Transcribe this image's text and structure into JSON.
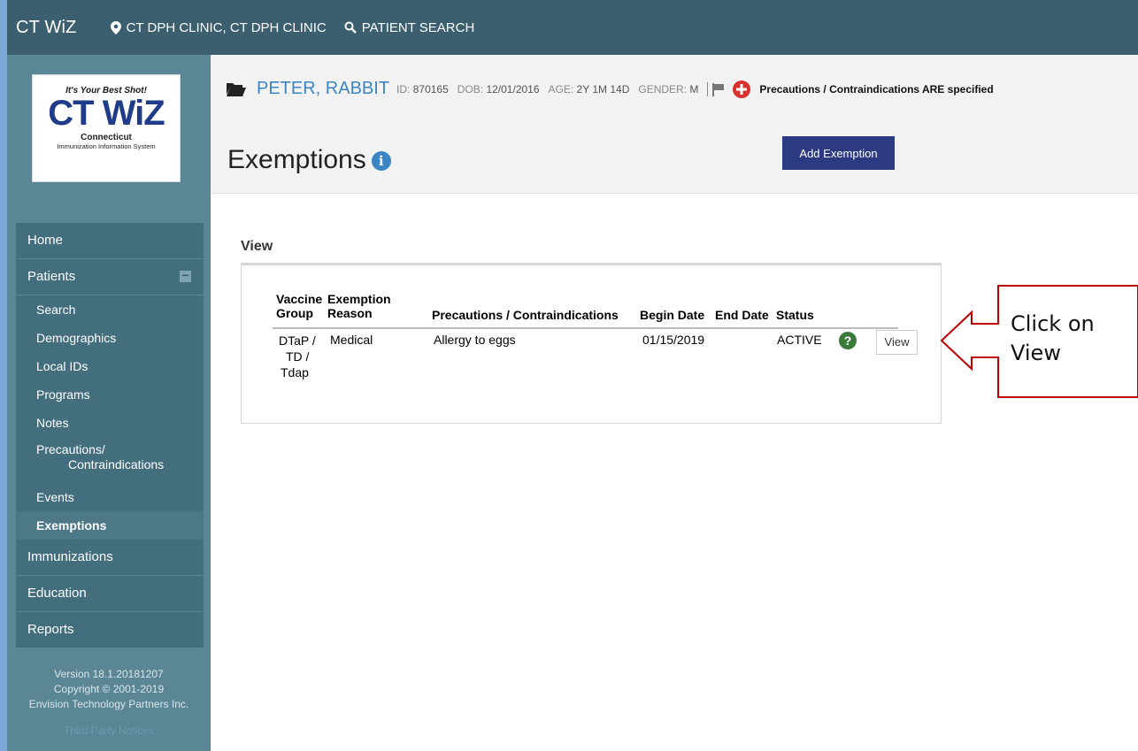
{
  "topbar": {
    "brand": "CT WiZ",
    "clinic": "CT DPH CLINIC, CT DPH CLINIC",
    "patient_search": "PATIENT SEARCH"
  },
  "logo": {
    "tagline": "It's Your Best Shot!",
    "name": "CT WiZ",
    "state": "Connecticut",
    "system": "Immunization Information System"
  },
  "sidebar": {
    "home": "Home",
    "patients": "Patients",
    "sub_items": [
      "Search",
      "Demographics",
      "Local IDs",
      "Programs",
      "Notes"
    ],
    "precautions_line1": "Precautions/",
    "precautions_line2": "Contraindications",
    "events": "Events",
    "exemptions": "Exemptions",
    "immunizations": "Immunizations",
    "education": "Education",
    "reports": "Reports",
    "version": "Version 18.1.20181207",
    "copyright": "Copyright © 2001-2019",
    "company": "Envision Technology Partners Inc.",
    "third_party": "Third Party Notices"
  },
  "patient": {
    "name": "PETER, RABBIT",
    "id_label": "ID:",
    "id": "870165",
    "dob_label": "DOB:",
    "dob": "12/01/2016",
    "age_label": "AGE:",
    "age": "2Y 1M 14D",
    "gender_label": "GENDER:",
    "gender": "M",
    "precautions_text": "Precautions / Contraindications ARE specified"
  },
  "page": {
    "title": "Exemptions",
    "add_button": "Add Exemption",
    "view_heading": "View"
  },
  "table": {
    "headers": {
      "vaccine_line1": "Vaccine",
      "vaccine_line2": "Group",
      "exemption_line1": "Exemption",
      "exemption_line2": "Reason",
      "precautions": "Precautions / Contraindications",
      "begin": "Begin Date",
      "end": "End Date",
      "status": "Status"
    },
    "row": {
      "vaccine_line1": "DTaP /",
      "vaccine_line2": "TD /",
      "vaccine_line3": "Tdap",
      "reason": "Medical",
      "precaution": "Allergy to eggs",
      "begin": "01/15/2019",
      "end": "",
      "status": "ACTIVE",
      "view_label": "View"
    }
  },
  "callout": {
    "line1": "Click on",
    "line2": "View"
  },
  "colors": {
    "topbar": "#3b5f6f",
    "sidebar": "#5b8696",
    "accent_blue": "#3c85c4",
    "button": "#2c3a82",
    "callout_border": "#c00000"
  }
}
